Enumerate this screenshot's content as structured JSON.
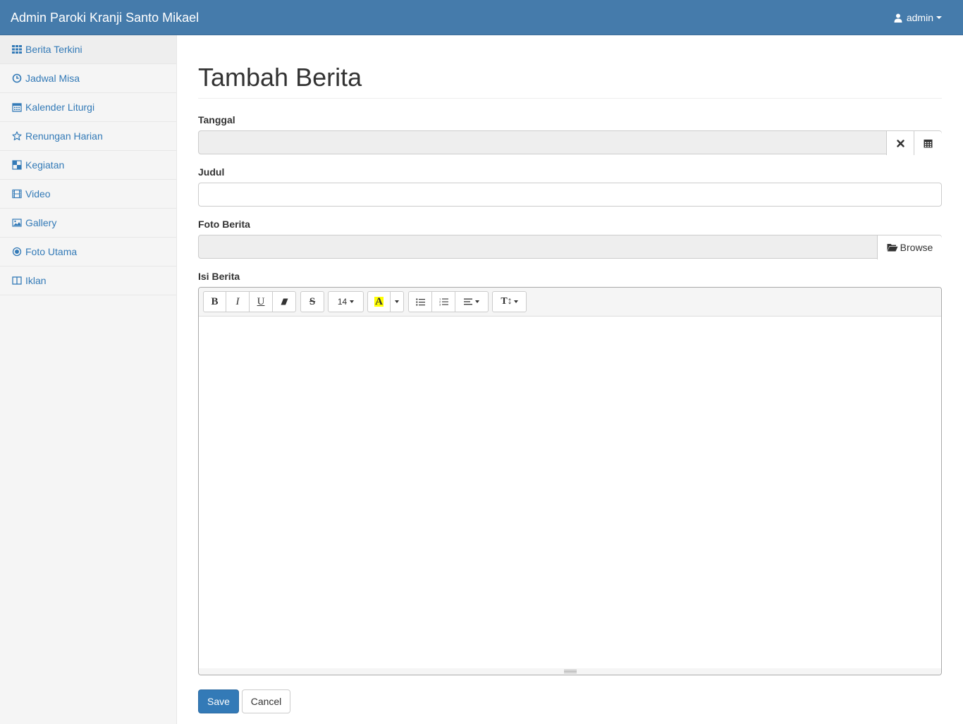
{
  "navbar": {
    "brand": "Admin Paroki Kranji Santo Mikael",
    "user": "admin"
  },
  "sidebar": {
    "items": [
      {
        "label": "Berita Terkini",
        "icon": "grid-icon"
      },
      {
        "label": "Jadwal Misa",
        "icon": "clock-icon"
      },
      {
        "label": "Kalender Liturgi",
        "icon": "calendar-icon"
      },
      {
        "label": "Renungan Harian",
        "icon": "star-icon"
      },
      {
        "label": "Kegiatan",
        "icon": "checkered-icon"
      },
      {
        "label": "Video",
        "icon": "film-icon"
      },
      {
        "label": "Gallery",
        "icon": "picture-icon"
      },
      {
        "label": "Foto Utama",
        "icon": "record-icon"
      },
      {
        "label": "Iklan",
        "icon": "columns-icon"
      }
    ],
    "active_index": 0
  },
  "page": {
    "title": "Tambah Berita"
  },
  "form": {
    "tanggal_label": "Tanggal",
    "tanggal_value": "",
    "judul_label": "Judul",
    "judul_value": "",
    "foto_label": "Foto Berita",
    "foto_value": "",
    "browse_label": "Browse",
    "isi_label": "Isi Berita",
    "isi_value": ""
  },
  "editor": {
    "bold": "B",
    "italic": "I",
    "underline": "U",
    "strike": "S",
    "font_size": "14",
    "color_letter": "A",
    "line_height": "T↕",
    "highlight_color": "#ffff00"
  },
  "buttons": {
    "save": "Save",
    "cancel": "Cancel"
  },
  "colors": {
    "navbar": "#457bab",
    "primary": "#337ab7",
    "link": "#337ab7"
  }
}
